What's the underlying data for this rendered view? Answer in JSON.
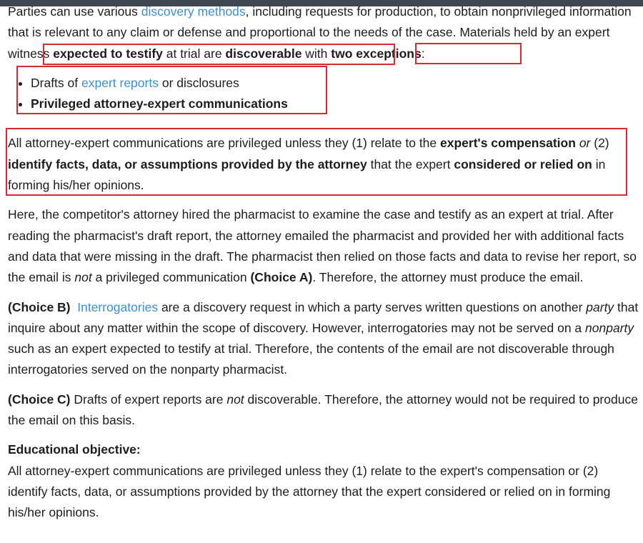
{
  "intro": {
    "t1": "Parties can use various ",
    "link1": "discovery methods",
    "t2": ", including requests for production, to obtain nonprivileged information that is relevant to any claim or defense and proportional to the needs of the case.  Materials held by an expert witness ",
    "b1": "expected to testify",
    "t3": " at trial are ",
    "b2": "discoverable",
    "t4": " with ",
    "b3": "two exceptions",
    "t5": ":"
  },
  "exceptions": {
    "item1_prefix": "Drafts of ",
    "item1_link": "expert reports",
    "item1_suffix": " or disclosures",
    "item2": "Privileged attorney-expert communications"
  },
  "rule": {
    "t1": "All attorney-expert communications are privileged unless they (1) relate to the ",
    "b1": "expert's compensation",
    "t2": " ",
    "i1": "or",
    "t3": " (2) ",
    "b2": "identify facts, data, or assumptions provided by the attorney",
    "t4": " that the expert ",
    "b3": "considered or relied on",
    "t5": " in forming his/her opinions."
  },
  "facts": {
    "t1": "Here, the competitor's attorney hired the pharmacist to examine the case and testify as an expert at trial.  After reading the pharmacist's draft report, the attorney emailed the pharmacist and provided her with additional facts and data that were missing in the draft.  The pharmacist then relied on those facts and data to revise her report, so the email is ",
    "i1": "not",
    "t2": " a privileged communication ",
    "b1": "(Choice A)",
    "t3": ".  Therefore, the attorney must produce the email."
  },
  "choice_b": {
    "label": "(Choice B)",
    "t0": "  ",
    "link": "Interrogatories",
    "t1": " are a discovery request in which a party serves written questions on another ",
    "i1": "party",
    "t2": " that inquire about any matter within the scope of discovery.  However, interrogatories may not be served on a ",
    "i2": "nonparty",
    "t3": " such as an expert expected to testify at trial.  Therefore, the contents of the email are not discoverable through interrogatories served on the nonparty pharmacist."
  },
  "choice_c": {
    "label": "(Choice C)",
    "t1": "  Drafts of expert reports are ",
    "i1": "not",
    "t2": " discoverable.  Therefore, the attorney would not be required to produce the email on this basis."
  },
  "objective": {
    "heading": "Educational objective:",
    "text": "All attorney-expert communications are privileged unless they (1) relate to the expert's compensation or (2) identify facts, data, or assumptions provided by the attorney that the expert considered or relied on in forming his/her opinions."
  },
  "colors": {
    "link": "#3a8fd8",
    "highlight": "#d72a35",
    "topbar": "#3e4650"
  }
}
